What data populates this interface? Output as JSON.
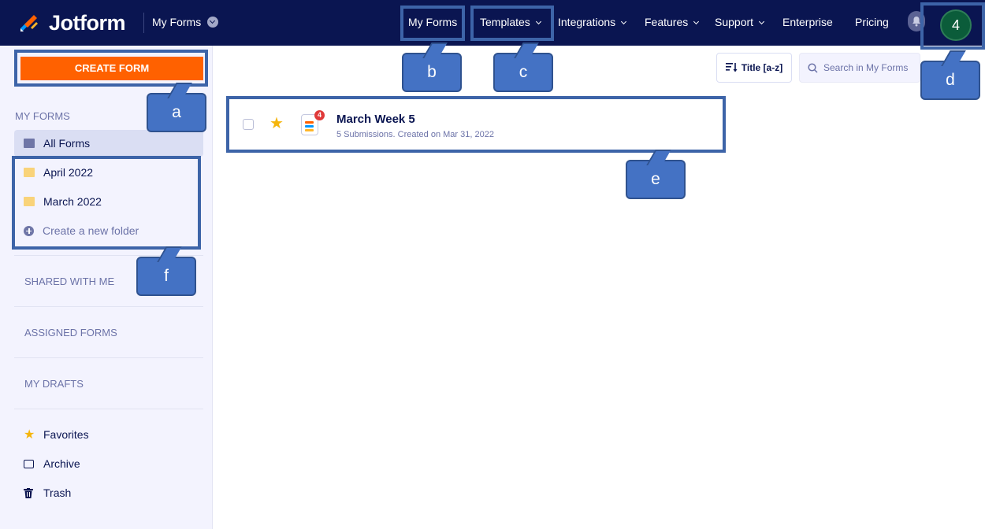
{
  "header": {
    "brand": "Jotform",
    "dropdown_label": "My Forms",
    "nav": [
      "My Forms",
      "Templates",
      "Integrations",
      "Features",
      "Support",
      "Enterprise",
      "Pricing"
    ],
    "avatar_initial": "4"
  },
  "sidebar": {
    "create_label": "CREATE FORM",
    "my_forms_heading": "MY FORMS",
    "all_forms": "All Forms",
    "folders": [
      "April 2022",
      "March 2022"
    ],
    "new_folder": "Create a new folder",
    "shared": "SHARED WITH ME",
    "assigned": "ASSIGNED FORMS",
    "drafts": "MY DRAFTS",
    "favorites": "Favorites",
    "archive": "Archive",
    "trash": "Trash"
  },
  "toolbar": {
    "sort_label": "Title [a-z]",
    "search_placeholder": "Search in My Forms"
  },
  "forms": [
    {
      "title": "March Week 5",
      "meta": "5 Submissions. Created on Mar 31, 2022",
      "badge": "4"
    }
  ],
  "annotations": [
    "a",
    "b",
    "c",
    "d",
    "e",
    "f"
  ],
  "colors": {
    "nav_bg": "#0a1551",
    "create_orange": "#ff6100",
    "annotation_blue": "#4472c4"
  }
}
